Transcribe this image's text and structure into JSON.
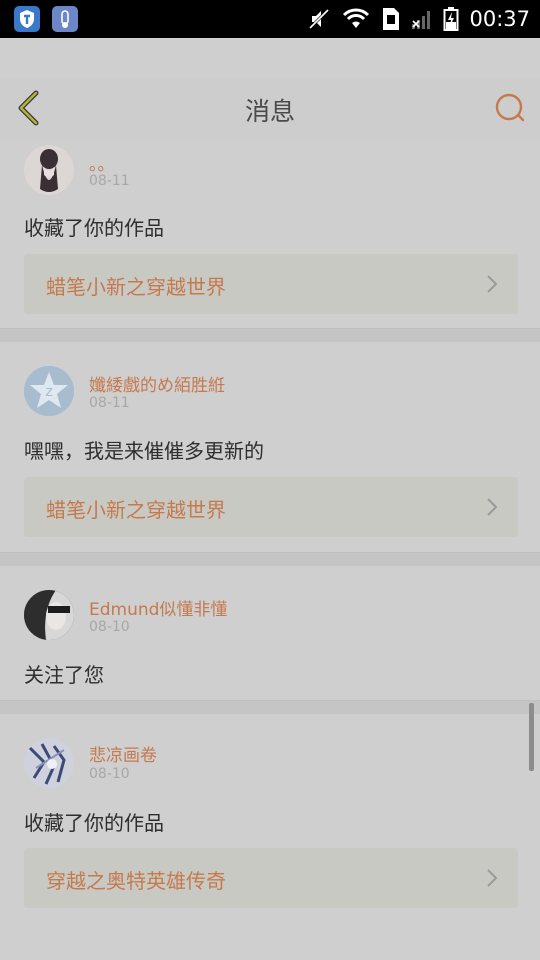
{
  "status_bar": {
    "time": "00:37",
    "icons": [
      "shield-icon",
      "app-icon",
      "mute-icon",
      "wifi-icon",
      "sim-icon",
      "signal-icon",
      "battery-charging-icon"
    ]
  },
  "header": {
    "title": "消息",
    "back_icon": "chevron-left-icon",
    "search_icon": "search-icon"
  },
  "colors": {
    "accent": "#c57a4e",
    "status_bar": "#000000",
    "background": "#cfcfcf"
  },
  "messages": [
    {
      "username": "。。",
      "date": "08-11",
      "text": "收藏了你的作品",
      "work_title": "蜡笔小新之穿越世界"
    },
    {
      "username": "孅緌戲的め絔胜絍",
      "date": "08-11",
      "text": "嘿嘿，我是来催催多更新的",
      "work_title": "蜡笔小新之穿越世界"
    },
    {
      "username": "Edmund似懂非懂",
      "date": "08-10",
      "text": "关注了您"
    },
    {
      "username": "悲凉画卷",
      "date": "08-10",
      "text": "收藏了你的作品",
      "work_title": "穿越之奥特英雄传奇"
    }
  ]
}
